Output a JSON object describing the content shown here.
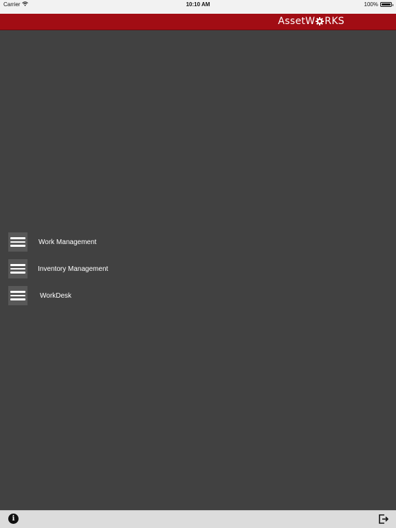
{
  "status_bar": {
    "carrier": "Carrier",
    "time": "10:10 AM",
    "battery": "100%"
  },
  "header": {
    "brand_prefix": "AssetW",
    "brand_suffix": "RKS",
    "brand_color": "#a10d14"
  },
  "menu": {
    "items": [
      {
        "label": "Work Management",
        "icon": "hamburger-menu-icon"
      },
      {
        "label": "Inventory Management",
        "icon": "hamburger-menu-icon"
      },
      {
        "label": "WorkDesk",
        "icon": "hamburger-menu-icon"
      }
    ]
  },
  "toolbar": {
    "info_icon": "info-icon",
    "info_glyph": "i",
    "logout_icon": "logout-icon"
  },
  "colors": {
    "background": "#414141",
    "header": "#a10d14",
    "toolbar": "#dcdcdc"
  }
}
